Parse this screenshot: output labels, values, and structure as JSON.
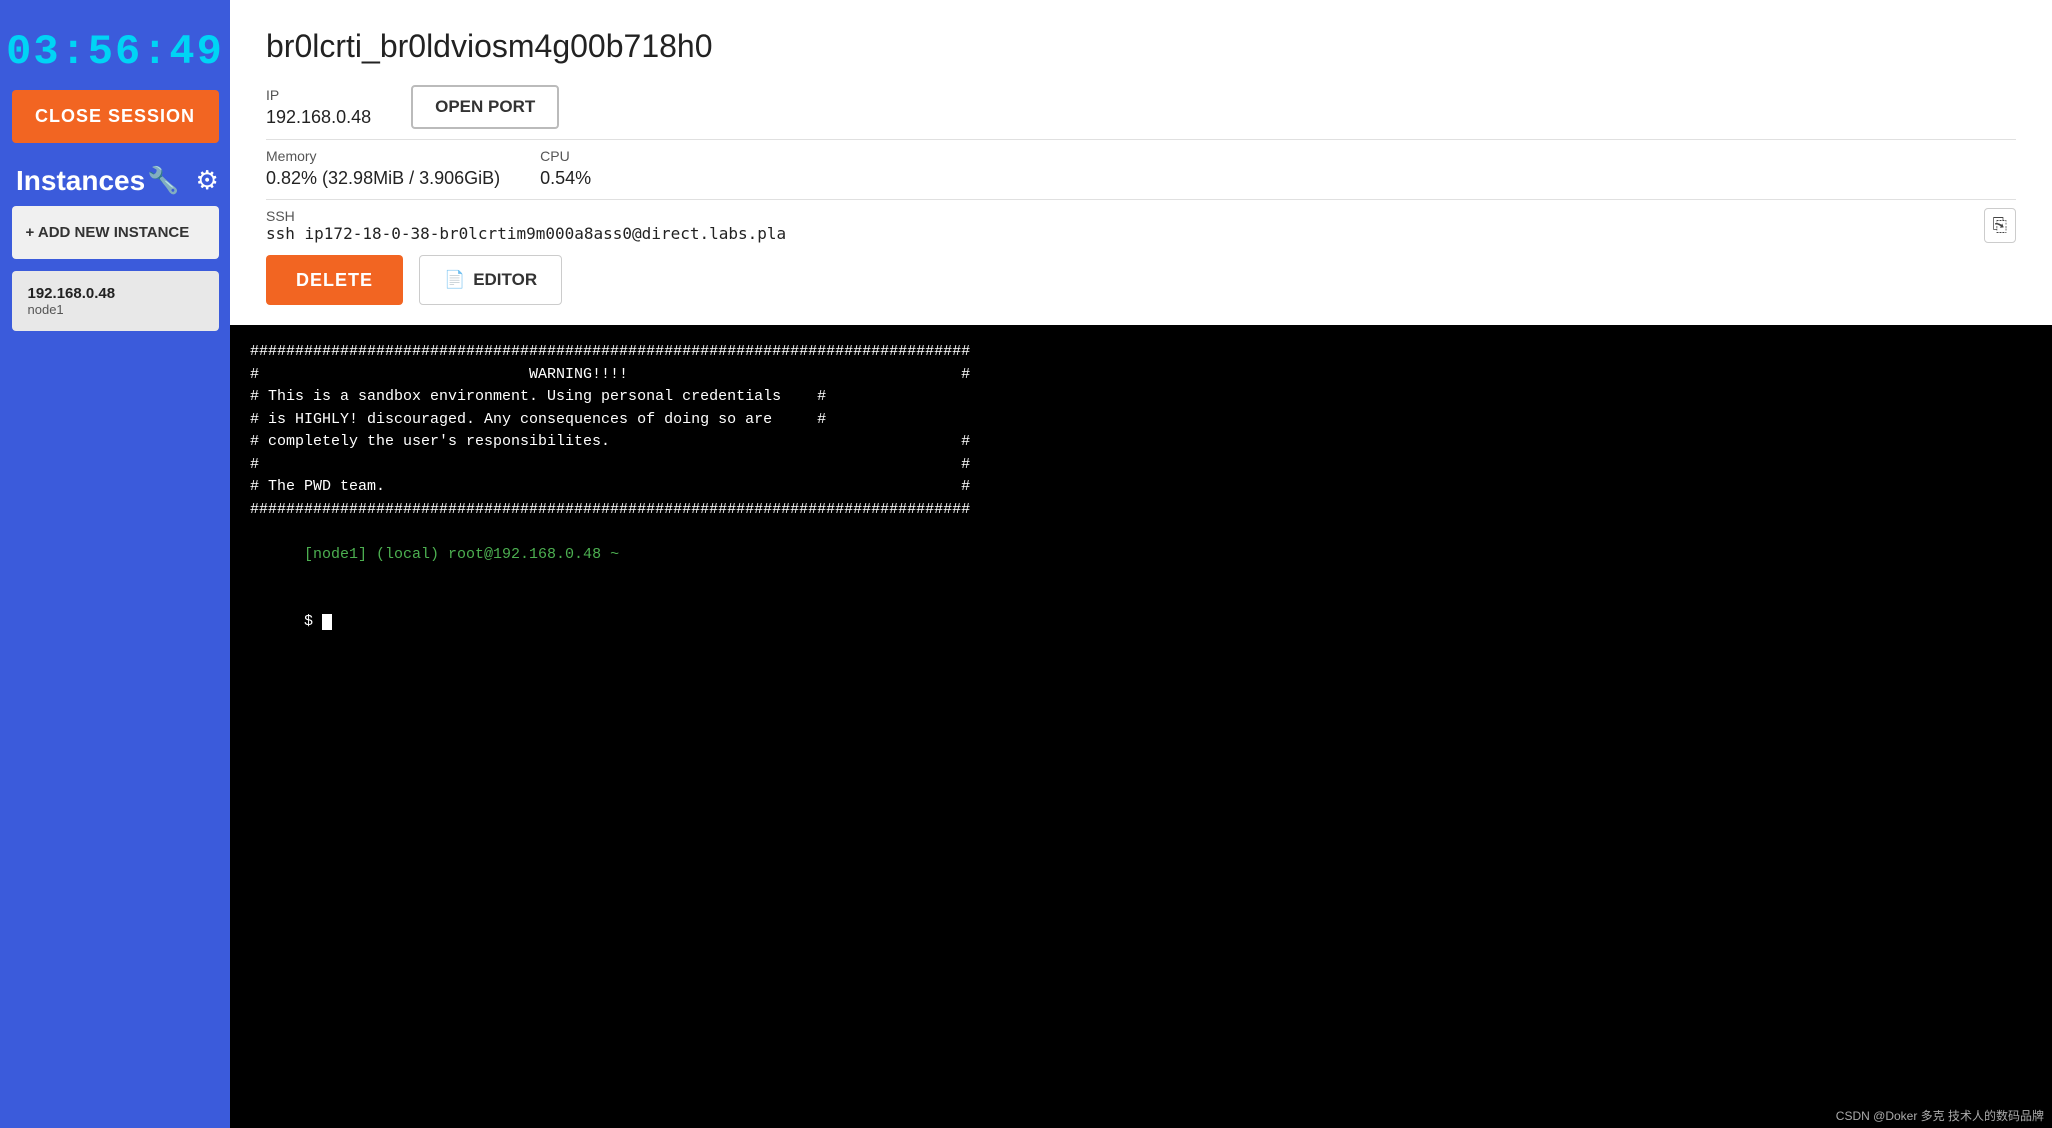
{
  "sidebar": {
    "timer": "03:56:49",
    "close_session_label": "CLOSE SESSION",
    "instances_title": "Instances",
    "add_instance_label": "+ ADD NEW INSTANCE",
    "instances": [
      {
        "ip": "192.168.0.48",
        "name": "node1"
      }
    ]
  },
  "main": {
    "instance_title": "br0lcrti_br0ldviosm4g00b718h0",
    "ip_label": "IP",
    "ip_value": "192.168.0.48",
    "open_port_label": "OPEN PORT",
    "memory_label": "Memory",
    "memory_value": "0.82% (32.98MiB / 3.906GiB)",
    "cpu_label": "CPU",
    "cpu_value": "0.54%",
    "ssh_label": "SSH",
    "ssh_value": "ssh ip172-18-0-38-br0lcrtim9m000a8ass0@direct.labs.pla",
    "delete_label": "DELETE",
    "editor_label": "EDITOR"
  },
  "terminal": {
    "lines": [
      "################################################################################",
      "#                              WARNING!!!!                                     #",
      "# This is a sandbox environment. Using personal credentials    #",
      "# is HIGHLY! discouraged. Any consequences of doing so are     #",
      "# completely the user's responsibilites.                                       #",
      "#                                                                              #",
      "# The PWD team.                                                                #",
      "################################################################################"
    ],
    "prompt_node": "[node1]",
    "prompt_local": " (local)",
    "prompt_user": " root@192.168.0.48 ~",
    "prompt_dollar": "$ "
  },
  "watermark": "CSDN @Doker 多克 技术人的数码品牌",
  "icons": {
    "wrench": "🔧",
    "gear": "⚙",
    "copy": "⎘",
    "file": "📄"
  }
}
